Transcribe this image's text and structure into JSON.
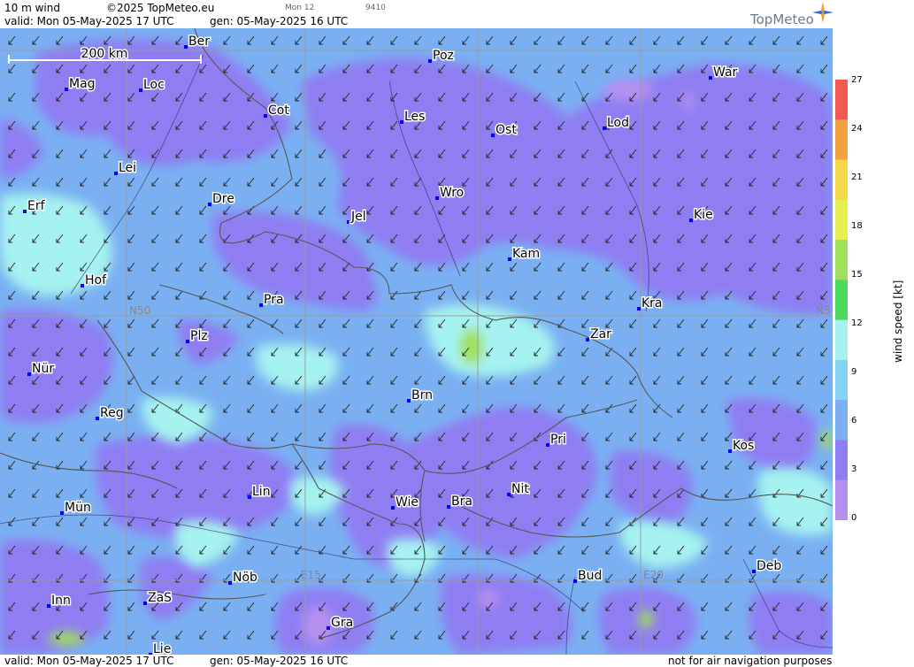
{
  "header": {
    "product": "10 m wind",
    "copyright": "©2025 TopMeteo.eu",
    "valid_line": "valid:  Mon  05-May-2025  17 UTC",
    "gen_line": "gen: 05-May-2025 16 UTC",
    "mon_tag": "Mon 12",
    "code_tag": "9410",
    "logo": "TopMeteo"
  },
  "footer": {
    "valid_line": "valid:  Mon  05-May-2025  17 UTC",
    "gen_line": "gen: 05-May-2025 16 UTC",
    "disclaimer": "not for air navigation purposes"
  },
  "scale_bar": "200 km",
  "grid_labels": {
    "lat50": "N50",
    "lon15": "E15",
    "lon20": "E20",
    "lat50_right": "N5"
  },
  "legend": {
    "title": "wind speed [kt]",
    "ticks": [
      "27",
      "24",
      "21",
      "18",
      "15",
      "12",
      "9",
      "6",
      "3",
      "0"
    ],
    "colors": [
      "#f05a50",
      "#f2a040",
      "#f5d84a",
      "#e6ef50",
      "#9ee05a",
      "#4ed85a",
      "#a6f2f0",
      "#82d4f4",
      "#7ab0f2",
      "#8f7ef2",
      "#b690f0"
    ]
  },
  "cities": [
    {
      "name": "Ber"
    },
    {
      "name": "Poz"
    },
    {
      "name": "War"
    },
    {
      "name": "Mag"
    },
    {
      "name": "Loc"
    },
    {
      "name": "Cot"
    },
    {
      "name": "Les"
    },
    {
      "name": "Ost"
    },
    {
      "name": "Lod"
    },
    {
      "name": "Lei"
    },
    {
      "name": "Wro"
    },
    {
      "name": "Erf"
    },
    {
      "name": "Dre"
    },
    {
      "name": "Jel"
    },
    {
      "name": "Kie"
    },
    {
      "name": "Kam"
    },
    {
      "name": "Hof"
    },
    {
      "name": "Pra"
    },
    {
      "name": "Kra"
    },
    {
      "name": "Zar"
    },
    {
      "name": "Plz"
    },
    {
      "name": "Nür"
    },
    {
      "name": "Brn"
    },
    {
      "name": "Reg"
    },
    {
      "name": "Pri"
    },
    {
      "name": "Kos"
    },
    {
      "name": "Lin"
    },
    {
      "name": "Nit"
    },
    {
      "name": "Wie"
    },
    {
      "name": "Bra"
    },
    {
      "name": "Mün"
    },
    {
      "name": "Deb"
    },
    {
      "name": "Nöb"
    },
    {
      "name": "Bud"
    },
    {
      "name": "Inn"
    },
    {
      "name": "ZaS"
    },
    {
      "name": "Gra"
    },
    {
      "name": "Lie"
    }
  ]
}
